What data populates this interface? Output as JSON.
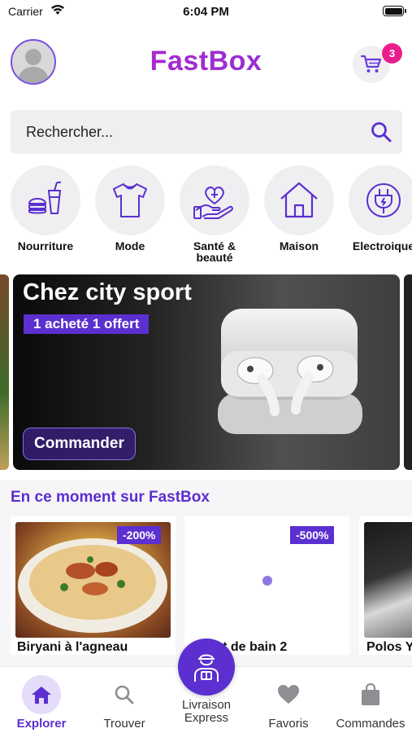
{
  "status_bar": {
    "carrier": "Carrier",
    "time": "6:04 PM"
  },
  "header": {
    "logo": "FastBox",
    "cart_count": "3"
  },
  "search": {
    "placeholder": "Rechercher..."
  },
  "categories": [
    {
      "label": "Nourriture",
      "icon": "food-icon"
    },
    {
      "label": "Mode",
      "icon": "tshirt-icon"
    },
    {
      "label": "Santé & beauté",
      "icon": "health-hand-icon"
    },
    {
      "label": "Maison",
      "icon": "house-icon"
    },
    {
      "label": "Electroique",
      "icon": "plug-icon"
    }
  ],
  "banner": {
    "title": "Chez city sport",
    "tag": "1 acheté 1 offert",
    "button": "Commander"
  },
  "section": {
    "title": "En ce moment sur FastBox",
    "cards": [
      {
        "name": "Biryani à l'agneau",
        "discount": "-200%"
      },
      {
        "name": "...ot de bain 2",
        "discount": "-500%"
      },
      {
        "name": "Polos Y",
        "discount": ""
      }
    ]
  },
  "tabs": [
    {
      "label": "Explorer",
      "active": true
    },
    {
      "label": "Trouver",
      "active": false
    },
    {
      "label": "Livraison Express",
      "active": false
    },
    {
      "label": "Favoris",
      "active": false
    },
    {
      "label": "Commandes",
      "active": false
    }
  ],
  "colors": {
    "primary": "#5b2fd0",
    "badge": "#e91e8c",
    "logo_start": "#c21fc0",
    "logo_end": "#7b3be0"
  }
}
